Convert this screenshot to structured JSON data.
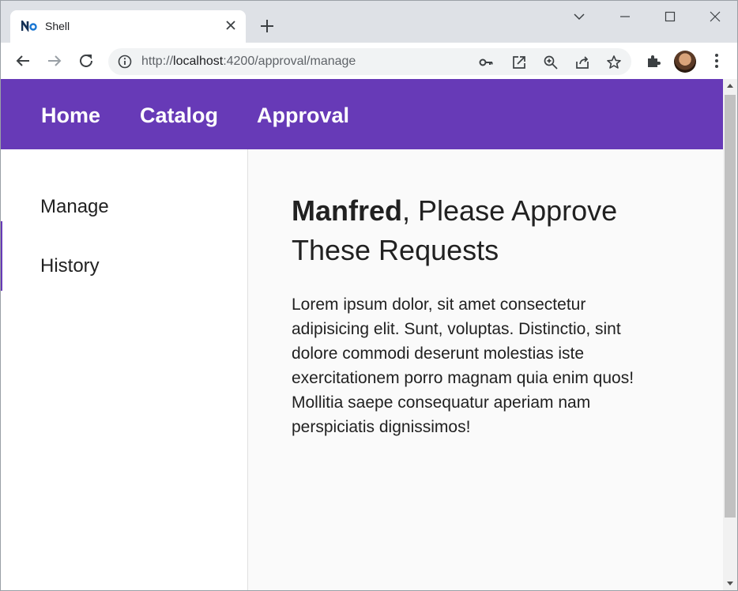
{
  "browser": {
    "tab_title": "Shell",
    "url_scheme": "http://",
    "url_host": "localhost",
    "url_path": ":4200/approval/manage",
    "accent": "#673ab7"
  },
  "appbar": {
    "links": [
      "Home",
      "Catalog",
      "Approval"
    ]
  },
  "sidebar": {
    "items": [
      "Manage",
      "History"
    ]
  },
  "main": {
    "user_name": "Manfred",
    "headline_rest": ", Please Approve These Requests",
    "body": "Lorem ipsum dolor, sit amet consectetur adipisicing elit. Sunt, voluptas. Distinctio, sint dolore commodi deserunt molestias iste exercitationem porro magnam quia enim quos! Mollitia saepe consequatur aperiam nam perspiciatis dignissimos!"
  },
  "icons": [
    "favicon-icon",
    "close-icon",
    "plus-icon",
    "chevron-down-icon",
    "minimize-icon",
    "maximize-icon",
    "close-window-icon",
    "back-icon",
    "forward-icon",
    "reload-icon",
    "info-icon",
    "key-icon",
    "open-external-icon",
    "zoom-icon",
    "share-icon",
    "star-icon",
    "extensions-icon",
    "menu-icon"
  ]
}
